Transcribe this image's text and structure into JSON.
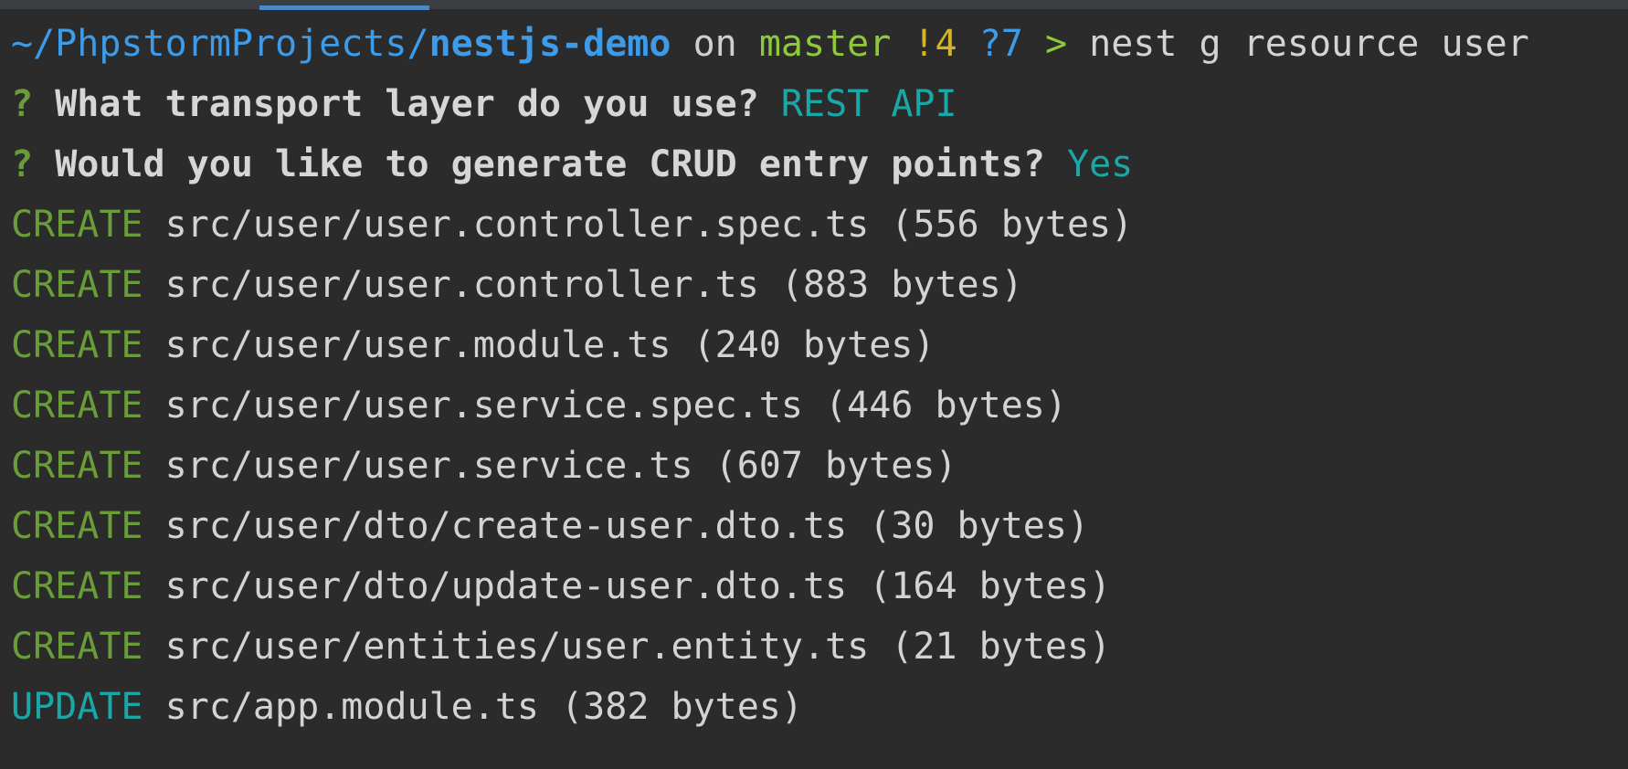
{
  "prompt": {
    "path_prefix": "~/PhpstormProjects/",
    "dir": "nestjs-demo",
    "on_text": "on",
    "branch": "master",
    "modified": "!4",
    "untracked": "?7",
    "arrow": ">",
    "command": "nest g resource user"
  },
  "questions": [
    {
      "mark": "?",
      "text": "What transport layer do you use?",
      "answer": "REST API"
    },
    {
      "mark": "?",
      "text": "Would you like to generate CRUD entry points?",
      "answer": "Yes"
    }
  ],
  "actions": [
    {
      "kind": "CREATE",
      "file": "src/user/user.controller.spec.ts (556 bytes)"
    },
    {
      "kind": "CREATE",
      "file": "src/user/user.controller.ts (883 bytes)"
    },
    {
      "kind": "CREATE",
      "file": "src/user/user.module.ts (240 bytes)"
    },
    {
      "kind": "CREATE",
      "file": "src/user/user.service.spec.ts (446 bytes)"
    },
    {
      "kind": "CREATE",
      "file": "src/user/user.service.ts (607 bytes)"
    },
    {
      "kind": "CREATE",
      "file": "src/user/dto/create-user.dto.ts (30 bytes)"
    },
    {
      "kind": "CREATE",
      "file": "src/user/dto/update-user.dto.ts (164 bytes)"
    },
    {
      "kind": "CREATE",
      "file": "src/user/entities/user.entity.ts (21 bytes)"
    },
    {
      "kind": "UPDATE",
      "file": "src/app.module.ts (382 bytes)"
    }
  ],
  "colors": {
    "background": "#2b2b2b",
    "path": "#3d9be9",
    "branch": "#8fc93a",
    "modified": "#d4b52a",
    "create": "#6a9c3a",
    "update": "#1ca7a7",
    "answer": "#1ca7a7",
    "tab_indicator": "#4a88c7"
  }
}
